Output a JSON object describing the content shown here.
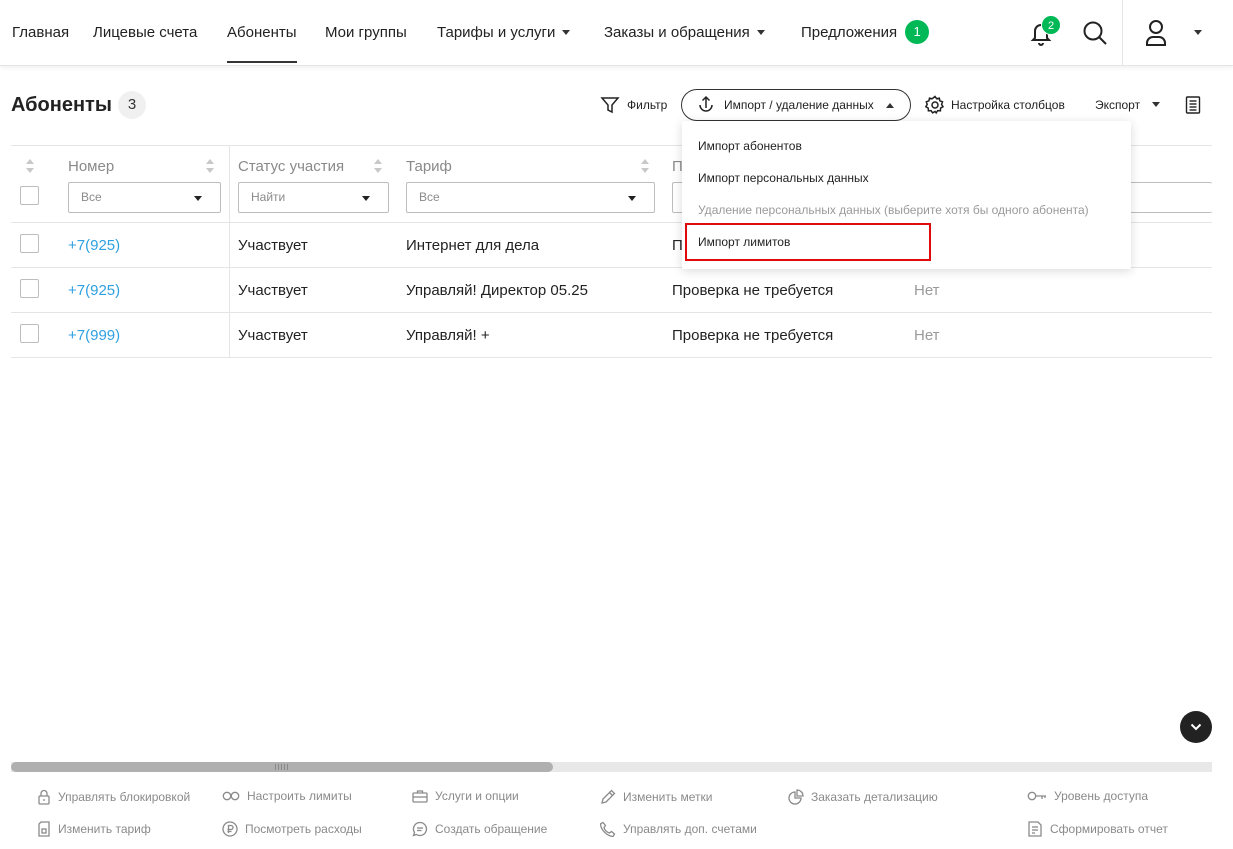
{
  "nav": {
    "items": [
      {
        "label": "Главная"
      },
      {
        "label": "Лицевые счета"
      },
      {
        "label": "Абоненты"
      },
      {
        "label": "Мои группы"
      },
      {
        "label": "Тарифы и услуги"
      },
      {
        "label": "Заказы и обращения"
      },
      {
        "label": "Предложения",
        "badge": "1"
      }
    ],
    "active": "Абоненты",
    "notifications_count": "2"
  },
  "page": {
    "title": "Абоненты",
    "count": "3"
  },
  "toolbar": {
    "filter_label": "Фильтр",
    "import_label": "Импорт / удаление данных",
    "columns_label": "Настройка столбцов",
    "export_label": "Экспорт"
  },
  "table": {
    "columns": [
      "Номер",
      "Статус участия",
      "Тариф",
      "П"
    ],
    "filters": {
      "number": "Все",
      "status": "Найти",
      "tariff": "Все"
    },
    "rows": [
      {
        "number": "+7(925)",
        "status": "Участвует",
        "tariff": "Интернет для дела",
        "check": "П",
        "extra": ""
      },
      {
        "number": "+7(925)",
        "status": "Участвует",
        "tariff": "Управляй! Директор 05.25",
        "check": "Проверка не требуется",
        "extra": "Нет"
      },
      {
        "number": "+7(999)",
        "status": "Участвует",
        "tariff": "Управляй! +",
        "check": "Проверка не требуется",
        "extra": "Нет"
      }
    ]
  },
  "dropdown": {
    "items": [
      {
        "label": "Импорт абонентов",
        "disabled": false
      },
      {
        "label": "Импорт персональных данных",
        "disabled": false
      },
      {
        "label": "Удаление персональных данных (выберите хотя бы одного абонента)",
        "disabled": true
      },
      {
        "label": "Импорт лимитов",
        "disabled": false,
        "highlighted": true
      }
    ]
  },
  "actions": {
    "row1": [
      "Управлять блокировкой",
      "Настроить лимиты",
      "Услуги и опции",
      "Изменить метки",
      "Заказать детализацию",
      "Уровень доступа"
    ],
    "row2": [
      "Изменить тариф",
      "Посмотреть расходы",
      "Создать обращение",
      "Управлять доп. счетами",
      "Сформировать отчет"
    ]
  },
  "colors": {
    "accent_green": "#00b956",
    "link_blue": "#2fa0e0",
    "highlight_red": "#e10a0a"
  }
}
